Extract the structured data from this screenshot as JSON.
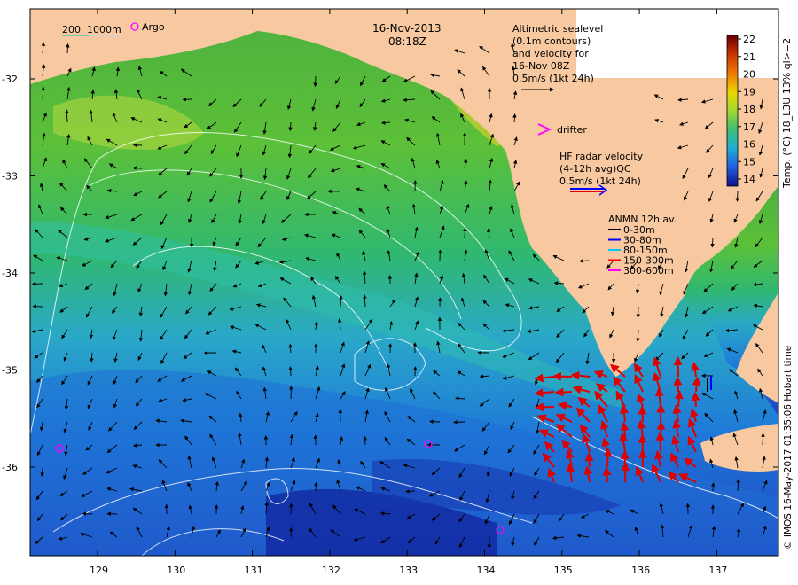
{
  "header": {
    "date": "16-Nov-2013",
    "time": "08:18Z"
  },
  "scale_legend": {
    "label_a": "200",
    "label_b": "1000m",
    "argo_label": "Argo"
  },
  "altimetry_legend": {
    "lines": [
      "Altimetric sealevel",
      "(0.1m contours)",
      "and velocity for",
      "16-Nov 08Z",
      "0.5m/s (1kt 24h)"
    ]
  },
  "drifter_legend": {
    "label": "drifter"
  },
  "hf_radar_legend": {
    "lines": [
      "HF radar velocity",
      "(4-12h avg)QC",
      "0.5m/s (1kt 24h)"
    ]
  },
  "anmn_legend": {
    "title": "ANMN 12h av.",
    "items": [
      {
        "label": "0-30m",
        "color": "#000000"
      },
      {
        "label": "30-80m",
        "color": "#0000ff"
      },
      {
        "label": "80-150m",
        "color": "#00c8ff"
      },
      {
        "label": "150-300m",
        "color": "#ff0000"
      },
      {
        "label": "300-600m",
        "color": "#ff00ff"
      }
    ]
  },
  "colorbar": {
    "label": "Temp. (°C) 18_L3U 13% ql>=2",
    "ticks": [
      "22",
      "21",
      "20",
      "19",
      "18",
      "17",
      "16",
      "15",
      "14"
    ]
  },
  "axes": {
    "x_ticks": [
      "129",
      "130",
      "131",
      "132",
      "133",
      "134",
      "135",
      "136",
      "137"
    ],
    "y_ticks": [
      "-32",
      "-33",
      "-34",
      "-35",
      "-36"
    ]
  },
  "credit": "© IMOS 16-May-2017 01:35:06 Hobart time",
  "colors": {
    "land": "#f8c9a0",
    "radar": "#e00000",
    "argo": "#ff00ff"
  }
}
